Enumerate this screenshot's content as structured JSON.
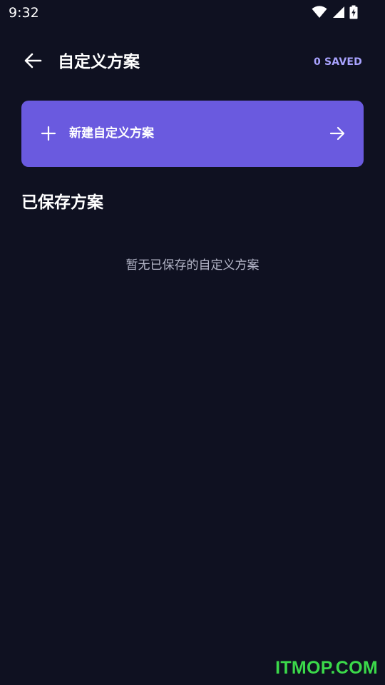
{
  "status_bar": {
    "time": "9:32",
    "icons": [
      "wifi-icon",
      "signal-icon",
      "battery-charging-icon"
    ]
  },
  "app_bar": {
    "back_icon": "arrow-left-icon",
    "title": "自定义方案",
    "saved_count": "0 SAVED"
  },
  "new_plan": {
    "icon": "plus-icon",
    "label": "新建自定义方案",
    "trailing_icon": "arrow-right-icon"
  },
  "saved_section": {
    "title": "已保存方案",
    "empty_message": "暂无已保存的自定义方案"
  },
  "watermark": "ITMOP.COM",
  "colors": {
    "background": "#0f1121",
    "accent": "#6a5adf",
    "accent_light": "#a9a3ff",
    "muted_text": "#b4b6c8",
    "watermark": "#3bd94a"
  }
}
